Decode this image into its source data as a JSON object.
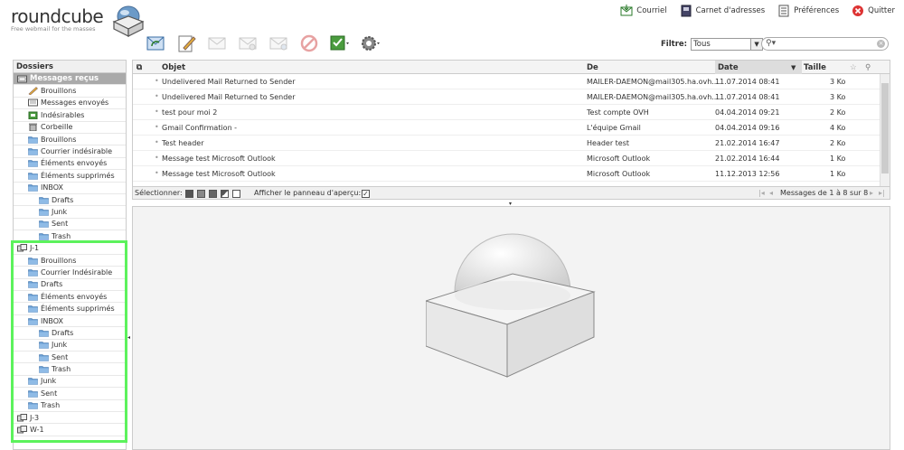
{
  "app": {
    "logo_text": "roundcube",
    "tagline": "Free webmail for the masses"
  },
  "topnav": [
    {
      "label": "Courriel",
      "icon": "mail-icon"
    },
    {
      "label": "Carnet d'adresses",
      "icon": "addressbook-icon"
    },
    {
      "label": "Préférences",
      "icon": "preferences-icon"
    },
    {
      "label": "Quitter",
      "icon": "logout-icon"
    }
  ],
  "toolbar": [
    {
      "name": "check-mail",
      "icon": "refresh-mail-icon"
    },
    {
      "name": "compose",
      "icon": "compose-icon"
    },
    {
      "name": "reply",
      "icon": "reply-icon"
    },
    {
      "name": "reply-all",
      "icon": "reply-all-icon"
    },
    {
      "name": "forward",
      "icon": "forward-icon"
    },
    {
      "name": "delete",
      "icon": "delete-icon"
    },
    {
      "name": "mark",
      "icon": "mark-icon"
    },
    {
      "name": "more",
      "icon": "gear-icon"
    }
  ],
  "filter": {
    "label": "Filtre:",
    "value": "Tous"
  },
  "search": {
    "placeholder": ""
  },
  "folders": {
    "title": "Dossiers",
    "items": [
      {
        "label": "Messages reçus",
        "indent": 0,
        "selected": true,
        "icon": "inbox-icon"
      },
      {
        "label": "Brouillons",
        "indent": 1,
        "icon": "drafts-icon"
      },
      {
        "label": "Messages envoyés",
        "indent": 1,
        "icon": "sent-icon"
      },
      {
        "label": "Indésirables",
        "indent": 1,
        "icon": "junk-icon"
      },
      {
        "label": "Corbeille",
        "indent": 1,
        "icon": "trash-icon"
      },
      {
        "label": "Brouillons",
        "indent": 1,
        "icon": "folder-icon"
      },
      {
        "label": "Courrier indésirable",
        "indent": 1,
        "icon": "folder-icon"
      },
      {
        "label": "Éléments envoyés",
        "indent": 1,
        "icon": "folder-icon"
      },
      {
        "label": "Éléments supprimés",
        "indent": 1,
        "icon": "folder-icon"
      },
      {
        "label": "INBOX",
        "indent": 1,
        "icon": "folder-icon"
      },
      {
        "label": "Drafts",
        "indent": 2,
        "icon": "folder-icon"
      },
      {
        "label": "Junk",
        "indent": 2,
        "icon": "folder-icon"
      },
      {
        "label": "Sent",
        "indent": 2,
        "icon": "folder-icon"
      },
      {
        "label": "Trash",
        "indent": 2,
        "icon": "folder-icon"
      },
      {
        "label": "J-1",
        "indent": 0,
        "icon": "shared-folder-icon"
      },
      {
        "label": "Brouillons",
        "indent": 1,
        "icon": "folder-icon"
      },
      {
        "label": "Courrier Indésirable",
        "indent": 1,
        "icon": "folder-icon"
      },
      {
        "label": "Drafts",
        "indent": 1,
        "icon": "folder-icon"
      },
      {
        "label": "Éléments envoyés",
        "indent": 1,
        "icon": "folder-icon"
      },
      {
        "label": "Éléments supprimés",
        "indent": 1,
        "icon": "folder-icon"
      },
      {
        "label": "INBOX",
        "indent": 1,
        "icon": "folder-icon"
      },
      {
        "label": "Drafts",
        "indent": 2,
        "icon": "folder-icon"
      },
      {
        "label": "Junk",
        "indent": 2,
        "icon": "folder-icon"
      },
      {
        "label": "Sent",
        "indent": 2,
        "icon": "folder-icon"
      },
      {
        "label": "Trash",
        "indent": 2,
        "icon": "folder-icon"
      },
      {
        "label": "Junk",
        "indent": 1,
        "icon": "folder-icon"
      },
      {
        "label": "Sent",
        "indent": 1,
        "icon": "folder-icon"
      },
      {
        "label": "Trash",
        "indent": 1,
        "icon": "folder-icon"
      },
      {
        "label": "J-3",
        "indent": 0,
        "icon": "shared-folder-icon"
      },
      {
        "label": "W-1",
        "indent": 0,
        "icon": "shared-folder-icon"
      }
    ]
  },
  "messages": {
    "columns": {
      "subject": "Objet",
      "from": "De",
      "date": "Date",
      "size": "Taille"
    },
    "rows": [
      {
        "subject": "Undelivered Mail Returned to Sender",
        "from": "MAILER-DAEMON@mail305.ha.ovh....",
        "date": "11.07.2014 08:41",
        "size": "3 Ko"
      },
      {
        "subject": "Undelivered Mail Returned to Sender",
        "from": "MAILER-DAEMON@mail305.ha.ovh....",
        "date": "11.07.2014 08:41",
        "size": "3 Ko"
      },
      {
        "subject": "test pour moi 2",
        "from": "Test compte OVH",
        "date": "04.04.2014 09:21",
        "size": "2 Ko"
      },
      {
        "subject": "Gmail Confirmation -",
        "from": "L'équipe Gmail",
        "date": "04.04.2014 09:16",
        "size": "4 Ko"
      },
      {
        "subject": "Test header",
        "from": "Header test",
        "date": "21.02.2014 16:47",
        "size": "2 Ko"
      },
      {
        "subject": "Message test Microsoft Outlook",
        "from": "Microsoft Outlook",
        "date": "21.02.2014 16:44",
        "size": "1 Ko"
      },
      {
        "subject": "Message test Microsoft Outlook",
        "from": "Microsoft Outlook",
        "date": "11.12.2013 12:56",
        "size": "1 Ko"
      }
    ]
  },
  "listfooter": {
    "select_label": "Sélectionner:",
    "preview_label": "Afficher le panneau d'aperçu:",
    "count": "Messages de 1 à 8 sur 8"
  },
  "colors": {
    "accent_green": "#5cf25c",
    "selected_folder": "#aaaaaa"
  }
}
